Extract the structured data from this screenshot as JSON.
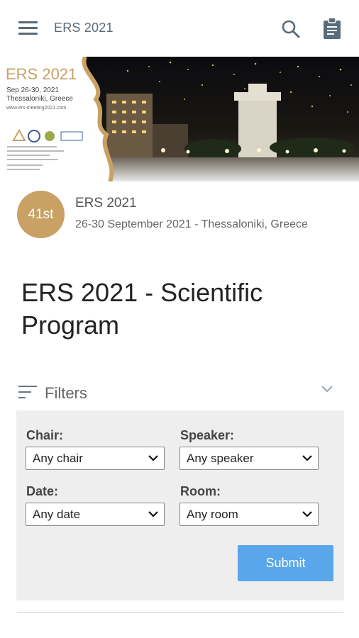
{
  "header": {
    "title": "ERS 2021",
    "menu_icon": "hamburger-menu-icon",
    "search_icon": "search-icon",
    "clipboard_icon": "clipboard-icon"
  },
  "banner": {
    "logo_title": "ERS 2021",
    "logo_dates": "Sep 26-30, 2021",
    "logo_city": "Thessaloniki, Greece",
    "logo_url": "www.ers-meeting2021.com",
    "accent_color": "#c9a164"
  },
  "event": {
    "badge": "41st",
    "name": "ERS 2021",
    "meta": "26-30 September 2021 - Thessaloniki, Greece"
  },
  "page": {
    "title": "ERS 2021 - Scientific Program"
  },
  "filters": {
    "label": "Filters",
    "chair": {
      "label": "Chair:",
      "value": "Any chair"
    },
    "speaker": {
      "label": "Speaker:",
      "value": "Any speaker"
    },
    "date": {
      "label": "Date:",
      "value": "Any date"
    },
    "room": {
      "label": "Room:",
      "value": "Any room"
    },
    "submit_label": "Submit",
    "submit_color": "#5aa6ea"
  }
}
